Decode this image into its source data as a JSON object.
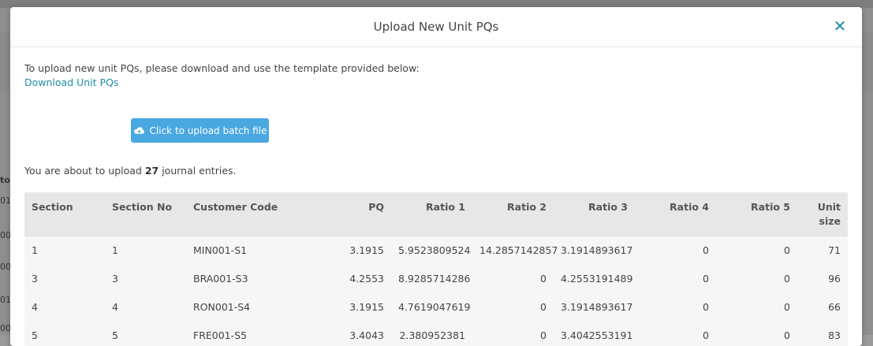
{
  "background": {
    "left_fragments": [
      "to",
      "01",
      "00",
      "00",
      "01",
      "00"
    ]
  },
  "modal": {
    "title": "Upload New Unit PQs",
    "close_symbol": "✕",
    "intro_text": "To upload new unit PQs, please download and use the template provided below:",
    "download_link": "Download Unit PQs",
    "upload_button": "Click to upload batch file",
    "summary_prefix": "You are about to upload ",
    "summary_count": "27",
    "summary_suffix": " journal entries."
  },
  "table": {
    "headers": [
      "Section",
      "Section No",
      "Customer Code",
      "PQ",
      "Ratio 1",
      "Ratio 2",
      "Ratio 3",
      "Ratio 4",
      "Ratio 5",
      "Unit size"
    ],
    "rows": [
      [
        "1",
        "1",
        "MIN001-S1",
        "3.1915",
        "5.9523809524",
        "14.2857142857",
        "3.1914893617",
        "0",
        "0",
        "71"
      ],
      [
        "3",
        "3",
        "BRA001-S3",
        "4.2553",
        "8.9285714286",
        "0",
        "4.2553191489",
        "0",
        "0",
        "96"
      ],
      [
        "4",
        "4",
        "RON001-S4",
        "3.1915",
        "4.7619047619",
        "0",
        "3.1914893617",
        "0",
        "0",
        "66"
      ],
      [
        "5",
        "5",
        "FRE001-S5",
        "3.4043",
        "2.380952381",
        "0",
        "3.4042553191",
        "0",
        "0",
        "83"
      ]
    ]
  },
  "colors": {
    "accent": "#1f8fa6",
    "button": "#4aa8e0",
    "header_bg": "#e7e7e7",
    "row_bg": "#f6f6f6"
  }
}
